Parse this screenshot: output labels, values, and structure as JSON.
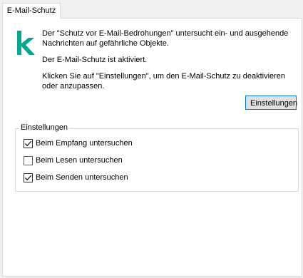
{
  "tab": {
    "label": "E-Mail-Schutz"
  },
  "info": {
    "line1": "Der \"Schutz vor E-Mail-Bedrohungen\" untersucht ein- und ausgehende Nachrichten auf gefährliche Objekte.",
    "line2": "Der E-Mail-Schutz ist aktiviert.",
    "line3": "Klicken Sie auf \"Einstellungen\", um den E-Mail-Schutz zu deaktivieren oder anzupassen."
  },
  "settings_button": {
    "label": "Einstellungen"
  },
  "settings_group": {
    "title": "Einstellungen",
    "options": [
      {
        "label": "Beim Empfang untersuchen",
        "checked": true
      },
      {
        "label": "Beim Lesen untersuchen",
        "checked": false
      },
      {
        "label": "Beim Senden untersuchen",
        "checked": true
      }
    ]
  },
  "colors": {
    "logo": "#00a88e",
    "focus": "#0078d7"
  },
  "icons": {
    "logo": "kaspersky-k-logo"
  }
}
